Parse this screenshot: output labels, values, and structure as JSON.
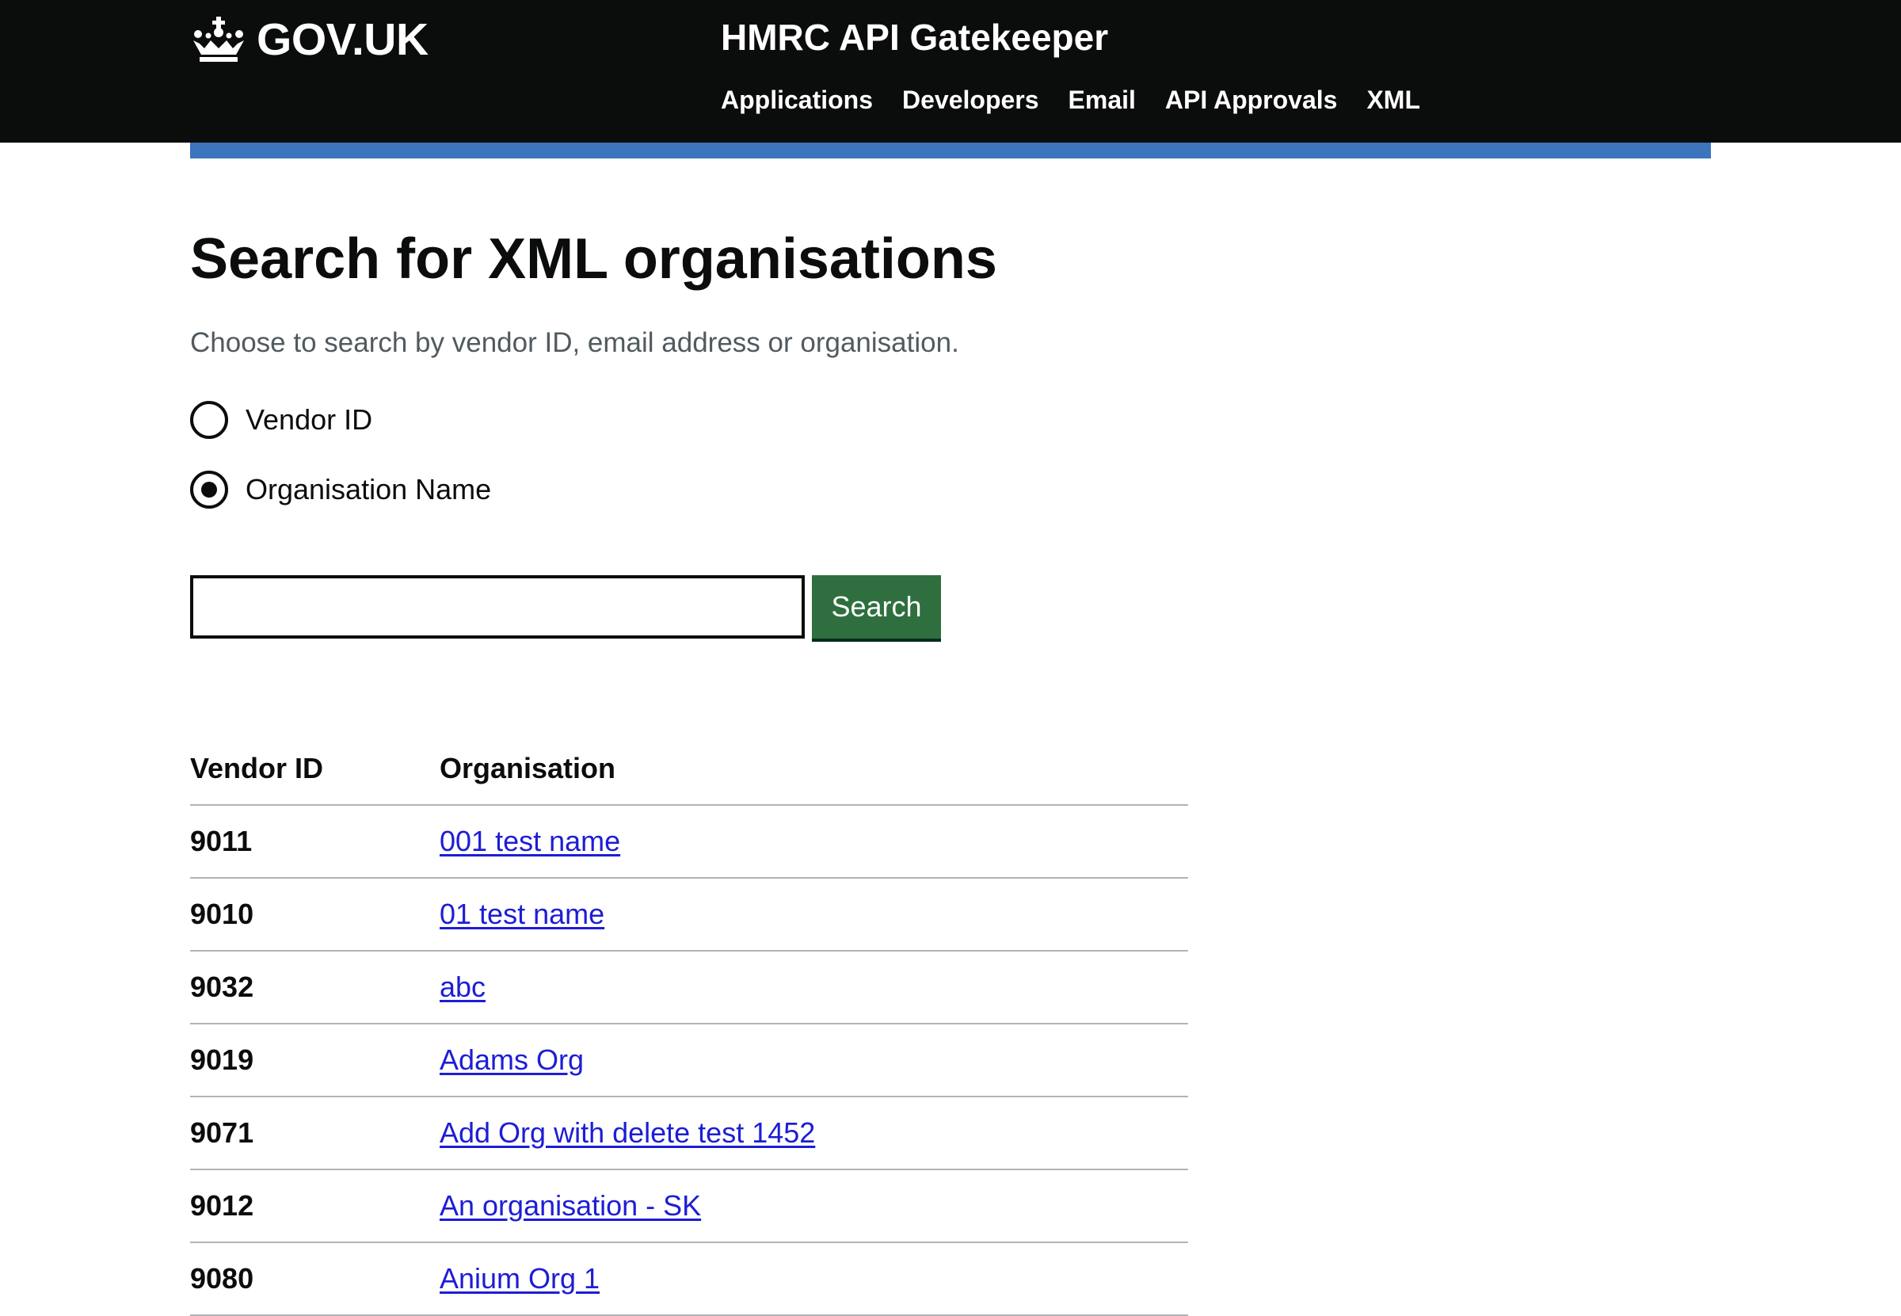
{
  "header": {
    "logo_text": "GOV.UK",
    "service_name": "HMRC API Gatekeeper",
    "nav": [
      "Applications",
      "Developers",
      "Email",
      "API Approvals",
      "XML"
    ]
  },
  "page": {
    "title": "Search for XML organisations",
    "hint": "Choose to search by vendor ID, email address or organisation."
  },
  "search": {
    "options": [
      {
        "label": "Vendor ID",
        "selected": false
      },
      {
        "label": "Organisation Name",
        "selected": true
      }
    ],
    "input_value": "",
    "button_label": "Search"
  },
  "results": {
    "headers": [
      "Vendor ID",
      "Organisation"
    ],
    "rows": [
      {
        "vendor_id": "9011",
        "organisation": "001 test name"
      },
      {
        "vendor_id": "9010",
        "organisation": "01 test name"
      },
      {
        "vendor_id": "9032",
        "organisation": "abc"
      },
      {
        "vendor_id": "9019",
        "organisation": "Adams Org"
      },
      {
        "vendor_id": "9071",
        "organisation": "Add Org with delete test 1452"
      },
      {
        "vendor_id": "9012",
        "organisation": "An organisation - SK"
      },
      {
        "vendor_id": "9080",
        "organisation": "Anium Org 1"
      }
    ]
  },
  "colors": {
    "header_bg": "#0b0c0c",
    "accent_bar": "#3c74bd",
    "button_green": "#2f6f3f",
    "link": "#1d1dd6"
  }
}
